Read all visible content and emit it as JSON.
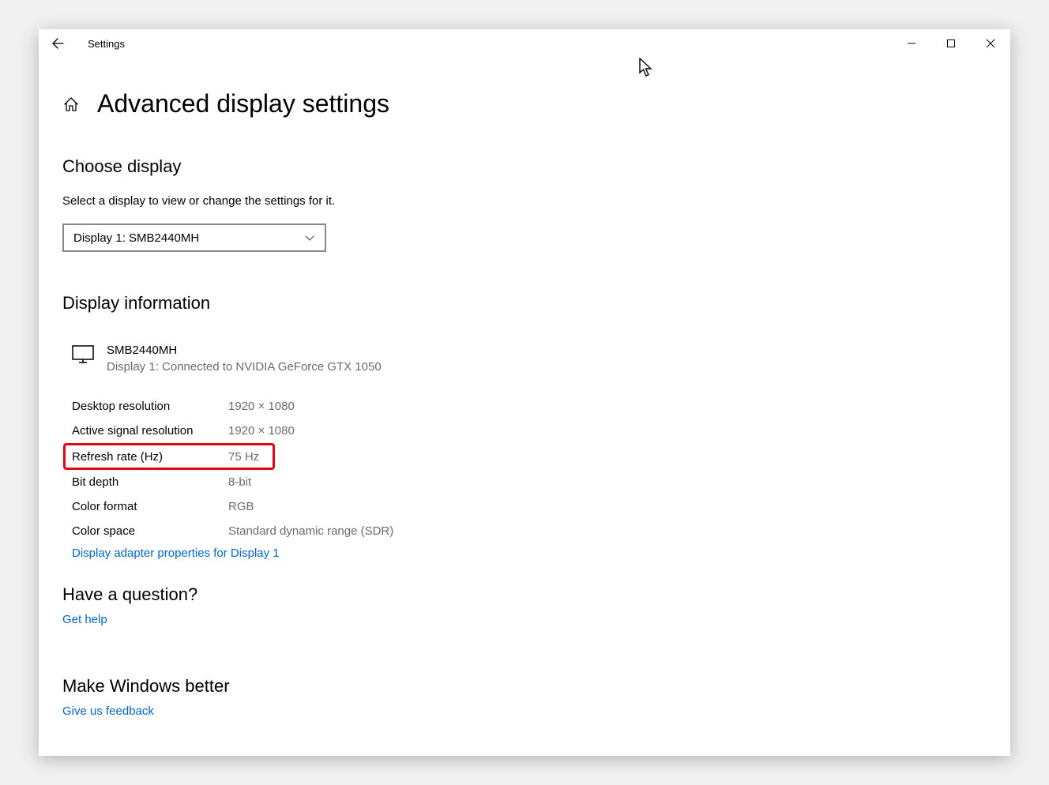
{
  "window": {
    "app_title": "Settings"
  },
  "page": {
    "title": "Advanced display settings"
  },
  "choose_display": {
    "heading": "Choose display",
    "instruction": "Select a display to view or change the settings for it.",
    "selected": "Display 1: SMB2440MH"
  },
  "display_info": {
    "heading": "Display information",
    "monitor_name": "SMB2440MH",
    "monitor_connection": "Display 1: Connected to NVIDIA GeForce GTX 1050",
    "rows": {
      "desktop_res_label": "Desktop resolution",
      "desktop_res_value": "1920 × 1080",
      "active_res_label": "Active signal resolution",
      "active_res_value": "1920 × 1080",
      "refresh_label": "Refresh rate (Hz)",
      "refresh_value": "75 Hz",
      "bitdepth_label": "Bit depth",
      "bitdepth_value": "8-bit",
      "colorfmt_label": "Color format",
      "colorfmt_value": "RGB",
      "colorspace_label": "Color space",
      "colorspace_value": "Standard dynamic range (SDR)"
    },
    "adapter_link": "Display adapter properties for Display 1"
  },
  "question": {
    "heading": "Have a question?",
    "link": "Get help"
  },
  "feedback": {
    "heading": "Make Windows better",
    "link": "Give us feedback"
  }
}
